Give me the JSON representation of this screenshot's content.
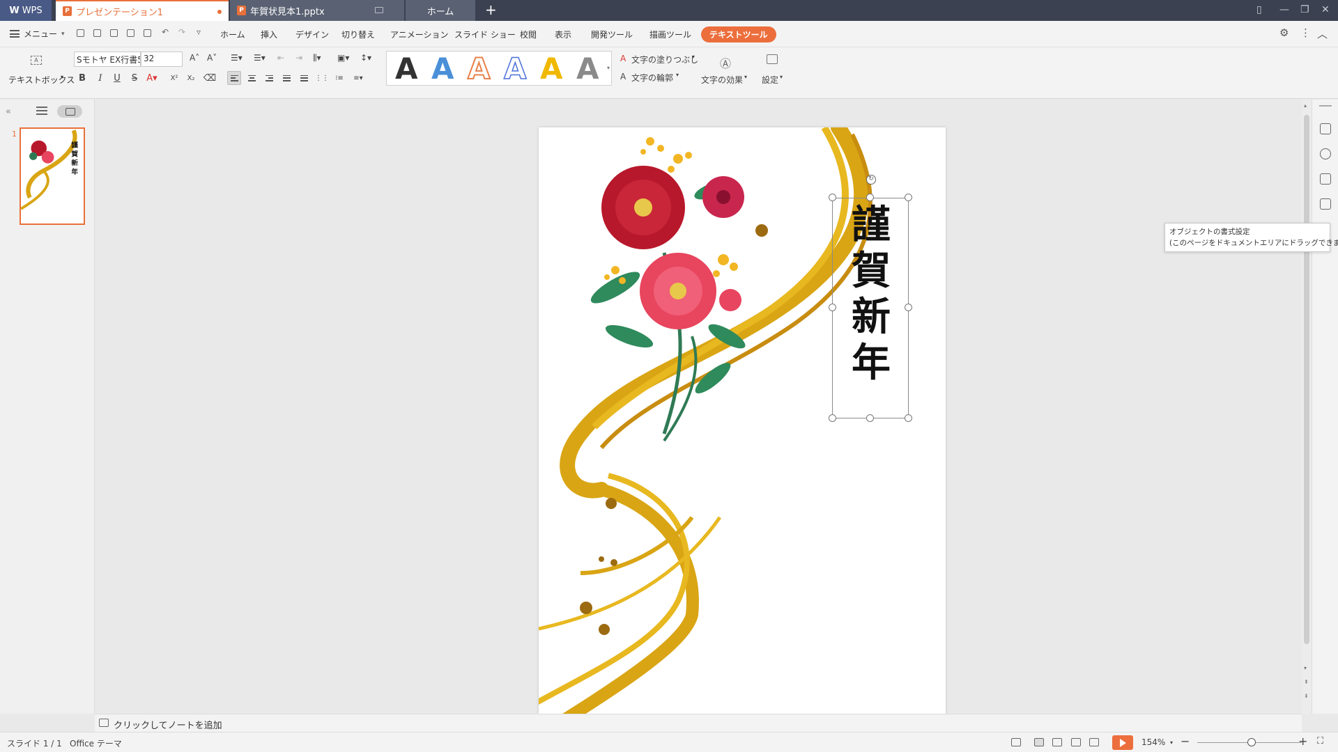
{
  "titlebar": {
    "wps_label": "WPS",
    "tabs": [
      {
        "label": "プレゼンテーション1",
        "modified": true
      },
      {
        "label": "年賀状見本1.pptx"
      },
      {
        "label": "ホーム"
      }
    ],
    "new_tab": "+"
  },
  "menubar": {
    "menu_label": "メニュー",
    "items": [
      "ホーム",
      "挿入",
      "デザイン",
      "切り替え",
      "アニメーション",
      "スライド ショー",
      "校閲",
      "表示",
      "開発ツール",
      "描画ツール",
      "テキストツール"
    ],
    "active_item": "テキストツール"
  },
  "ribbon": {
    "textbox_label": "テキストボックス",
    "font_name": "Sモトヤ EX行書5",
    "font_size": "32",
    "text_fill_label": "文字の塗りつぶし",
    "text_outline_label": "文字の輪郭",
    "text_effect_label": "文字の効果",
    "settings_label": "設定",
    "style_gallery": [
      "A",
      "A",
      "A",
      "A",
      "A",
      "A"
    ],
    "style_colors": [
      "#111111",
      "#4a8fd8",
      "#e8804a",
      "#4a8fd8",
      "#f0b800",
      "#8a8a8a"
    ]
  },
  "slide": {
    "vertical_text": [
      "謹",
      "賀",
      "新",
      "年"
    ]
  },
  "tooltip": {
    "line1": "オブジェクトの書式設定",
    "line2": "(このページをドキュメントエリアにドラッグできます)"
  },
  "notes": {
    "placeholder": "クリックしてノートを追加"
  },
  "status": {
    "slide_info": "スライド 1 / 1",
    "theme": "Office テーマ",
    "zoom": "154%"
  },
  "colors": {
    "accent": "#ec6e3c",
    "titlebar": "#3b4150",
    "gold": "#d9a514"
  }
}
